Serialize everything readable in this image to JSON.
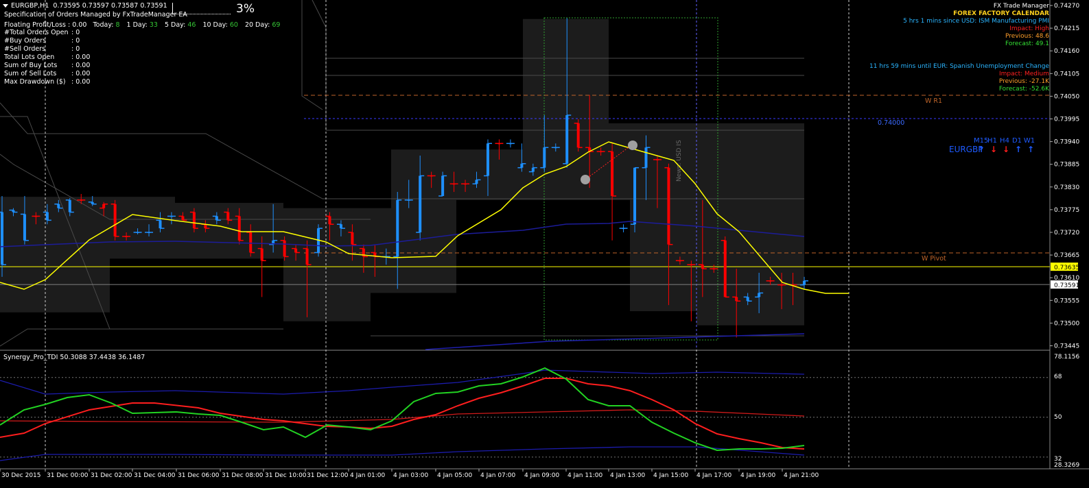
{
  "symbol_bar": {
    "symbol": "EURGBP,H1",
    "ohlc": "0.73595 0.73597 0.73587 0.73591"
  },
  "ea": {
    "title": "Specification of Orders Managed by FxTradeManager EA",
    "percent": "3%",
    "floating_label": "Floating Profit/Loss",
    "floating_value": ": 0.00",
    "periods": [
      {
        "label": "Today:",
        "value": "8"
      },
      {
        "label": "1 Day:",
        "value": "33"
      },
      {
        "label": "5 Day:",
        "value": "46"
      },
      {
        "label": "10 Day:",
        "value": "60"
      },
      {
        "label": "20 Day:",
        "value": "69"
      }
    ],
    "rows": [
      {
        "label": "#Total Orders Open",
        "value": ": 0"
      },
      {
        "label": "#Buy Orders",
        "value": ": 0"
      },
      {
        "label": "#Sell Orders",
        "value": ": 0"
      },
      {
        "label": "Total Lots Open",
        "value": ": 0.00"
      },
      {
        "label": "Sum of Buy Lots",
        "value": ": 0.00"
      },
      {
        "label": "Sum of Sell Lots",
        "value": ": 0.00"
      },
      {
        "label": "Max Drawdown ($)",
        "value": ": 0.00"
      }
    ]
  },
  "calendar": {
    "header": "FX Trade Manager",
    "title": "FOREX FACTORY CALENDAR",
    "events": [
      {
        "time": "5 hrs 1 mins since USD: ISM Manufacturing PMI",
        "impact": "Impact: High",
        "previous": "Previous: 48.6",
        "forecast": "Forecast: 49.1"
      },
      {
        "time": "11 hrs 59 mins until EUR: Spanish Unemployment Change",
        "impact": "Impact: Medium",
        "previous": "Previous: -27.1K",
        "forecast": "Forecast: -52.6K"
      }
    ]
  },
  "timeframes": {
    "labels": [
      "M15",
      "H1",
      "H4",
      "D1",
      "W1"
    ],
    "pair": "EURGBP",
    "directions": [
      "up",
      "down",
      "down",
      "up",
      "up"
    ]
  },
  "price_axis": {
    "ticks": [
      "0.74270",
      "0.74215",
      "0.74160",
      "0.74105",
      "0.74050",
      "0.73995",
      "0.73940",
      "0.73885",
      "0.73830",
      "0.73775",
      "0.73720",
      "0.73665",
      "0.73610",
      "0.73555",
      "0.73500",
      "0.73445"
    ],
    "current_price": "0.73591",
    "yellow_level": "0.73635"
  },
  "levels": {
    "wr1": "W R1",
    "wpivot": "W Pivot",
    "round": "0.74000"
  },
  "news_marker": "News: USD IS",
  "indicator": {
    "title": "Synergy_Pro_TDI 50.3088 37.4438 36.1487",
    "axis": [
      "78.1156",
      "68",
      "50",
      "32",
      "28.3269"
    ]
  },
  "time_axis": [
    "30 Dec 2015",
    "31 Dec 00:00",
    "31 Dec 02:00",
    "31 Dec 04:00",
    "31 Dec 06:00",
    "31 Dec 08:00",
    "31 Dec 10:00",
    "31 Dec 12:00",
    "4 Jan 01:00",
    "4 Jan 03:00",
    "4 Jan 05:00",
    "4 Jan 07:00",
    "4 Jan 09:00",
    "4 Jan 11:00",
    "4 Jan 13:00",
    "4 Jan 15:00",
    "4 Jan 17:00",
    "4 Jan 19:00",
    "4 Jan 21:00"
  ],
  "colors": {
    "bull": "#1e90ff",
    "bear": "#ff0000",
    "ma": "#ffff00",
    "slow_ma": "#1c1c9a",
    "grid": "#3a3a3a",
    "axis": "#b0b0b0",
    "session_box": "#1a1a1a",
    "tdi_green": "#22d322",
    "tdi_red": "#ff1e1e",
    "tdi_band": "#1c1cae"
  }
}
